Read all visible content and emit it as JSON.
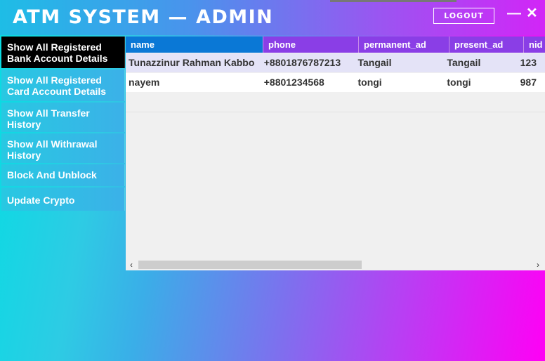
{
  "header": {
    "title": "ATM SYSTEM — ADMIN",
    "logout_label": "LOGOUT",
    "minimize_glyph": "—",
    "close_glyph": "✕"
  },
  "sidebar": {
    "items": [
      {
        "label": "Show All Registered Bank Account Details"
      },
      {
        "label": "Show All Registered Card Account Details"
      },
      {
        "label": "Show All Transfer History"
      },
      {
        "label": "Show All Withrawal History"
      },
      {
        "label": "Block And Unblock"
      },
      {
        "label": "Update Crypto"
      }
    ]
  },
  "table": {
    "columns": [
      "name",
      "phone",
      "permanent_ad",
      "present_ad",
      "nid"
    ],
    "rows": [
      [
        "Tunazzinur Rahman Kabbo",
        "+8801876787213",
        "Tangail",
        "Tangail",
        "123"
      ],
      [
        "nayem",
        "+8801234568",
        "tongi",
        "tongi",
        "987"
      ]
    ]
  },
  "icons": {
    "scroll_left": "arrow-left-icon",
    "scroll_right": "arrow-right-icon"
  },
  "colors": {
    "active_sidebar": "#000000",
    "header_col_first": "#0a78d6",
    "header_col": "#8a3ee6"
  }
}
